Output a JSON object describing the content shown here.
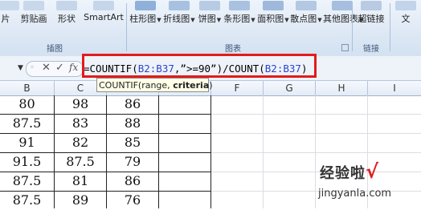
{
  "ribbon": {
    "items": [
      {
        "label": "片",
        "dropdown": false
      },
      {
        "label": "剪贴画",
        "dropdown": false
      },
      {
        "label": "形状",
        "dropdown": false
      },
      {
        "label": "SmartArt",
        "dropdown": false
      },
      {
        "label": "柱形图",
        "dropdown": true
      },
      {
        "label": "折线图",
        "dropdown": true
      },
      {
        "label": "饼图",
        "dropdown": true
      },
      {
        "label": "条形图",
        "dropdown": true
      },
      {
        "label": "面积图",
        "dropdown": true
      },
      {
        "label": "散点图",
        "dropdown": true
      },
      {
        "label": "其他图表",
        "dropdown": true
      },
      {
        "label": "超链接",
        "dropdown": false
      },
      {
        "label": "文",
        "dropdown": false
      }
    ],
    "groups": [
      "插图",
      "图表",
      "链接"
    ]
  },
  "formula_bar": {
    "name_box_arrow": "▼",
    "cancel": "✕",
    "enter": "✓",
    "fx": "fx",
    "formula_parts": [
      "=COUNTIF(",
      "B2:B37",
      ",”>=90”)/COUNT(",
      "B2:B37",
      ")"
    ]
  },
  "tooltip": {
    "func": "COUNTIF(range, ",
    "bold": "criteria",
    "close": ")"
  },
  "columns": [
    "B",
    "C",
    "D",
    "E",
    "F",
    "G",
    "H",
    "I"
  ],
  "rows": [
    [
      "80",
      "98",
      "86"
    ],
    [
      "87.5",
      "83",
      "88"
    ],
    [
      "91",
      "82",
      "85"
    ],
    [
      "91.5",
      "87.5",
      "79"
    ],
    [
      "87.5",
      "81",
      "86"
    ],
    [
      "87.5",
      "89",
      "76"
    ]
  ],
  "watermark": {
    "main": "经验啦",
    "check": "√",
    "sub": "jingyanla.com"
  }
}
